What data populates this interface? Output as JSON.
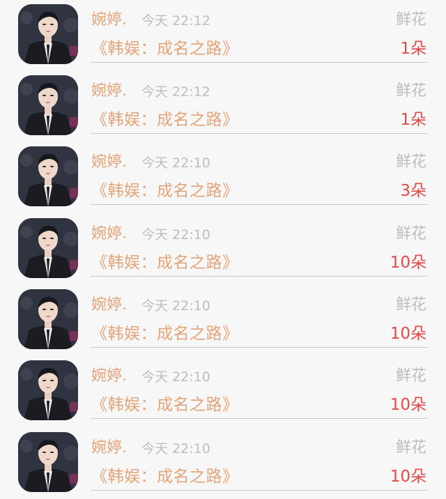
{
  "records": [
    {
      "user": "婉婷.",
      "time": "今天 22:12",
      "gift": "鲜花",
      "book": "《韩娱：成名之路》",
      "count": "1朵"
    },
    {
      "user": "婉婷.",
      "time": "今天 22:12",
      "gift": "鲜花",
      "book": "《韩娱：成名之路》",
      "count": "1朵"
    },
    {
      "user": "婉婷.",
      "time": "今天 22:10",
      "gift": "鲜花",
      "book": "《韩娱：成名之路》",
      "count": "3朵"
    },
    {
      "user": "婉婷.",
      "time": "今天 22:10",
      "gift": "鲜花",
      "book": "《韩娱：成名之路》",
      "count": "10朵"
    },
    {
      "user": "婉婷.",
      "time": "今天 22:10",
      "gift": "鲜花",
      "book": "《韩娱：成名之路》",
      "count": "10朵"
    },
    {
      "user": "婉婷.",
      "time": "今天 22:10",
      "gift": "鲜花",
      "book": "《韩娱：成名之路》",
      "count": "10朵"
    },
    {
      "user": "婉婷.",
      "time": "今天 22:10",
      "gift": "鲜花",
      "book": "《韩娱：成名之路》",
      "count": "10朵"
    }
  ],
  "colors": {
    "accent": "#e3a47a",
    "count": "#e14a4a",
    "muted": "#bdbdbd",
    "background": "#f7f7f7"
  }
}
